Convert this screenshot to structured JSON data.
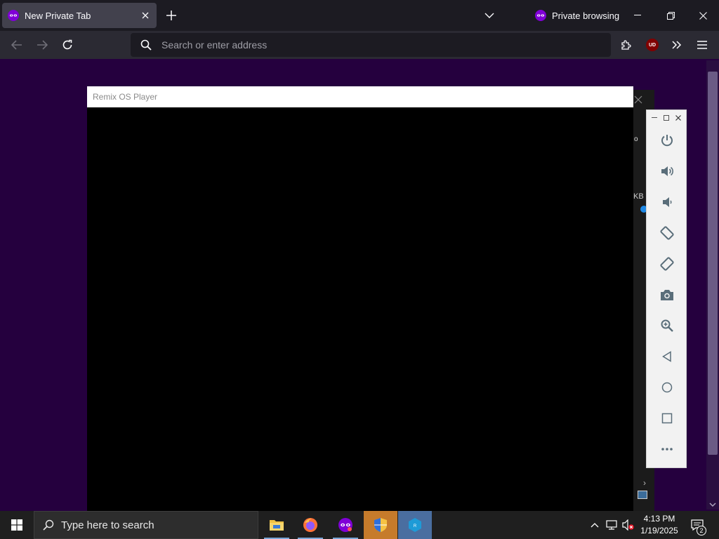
{
  "browser": {
    "tab": {
      "title": "New Private Tab"
    },
    "private_label": "Private browsing",
    "urlbar": {
      "placeholder": "Search or enter address",
      "value": ""
    },
    "extension_badge": "UD"
  },
  "remix": {
    "title": "Remix OS Player",
    "tools": [
      "power-icon",
      "volume-up-icon",
      "volume-down-icon",
      "rotate-left-icon",
      "rotate-right-icon",
      "camera-icon",
      "zoom-icon",
      "back-icon",
      "home-icon",
      "recents-icon",
      "more-icon"
    ]
  },
  "behind_window": {
    "o_text": "o",
    "kb_text": "KB",
    "chevron": "›"
  },
  "taskbar": {
    "search_placeholder": "Type here to search",
    "time": "4:13 PM",
    "date": "1/19/2025",
    "notification_count": "2"
  },
  "colors": {
    "page_bg": "#25003e",
    "private_purple": "#8000d7",
    "taskbar_bg": "#1f1f1f"
  }
}
